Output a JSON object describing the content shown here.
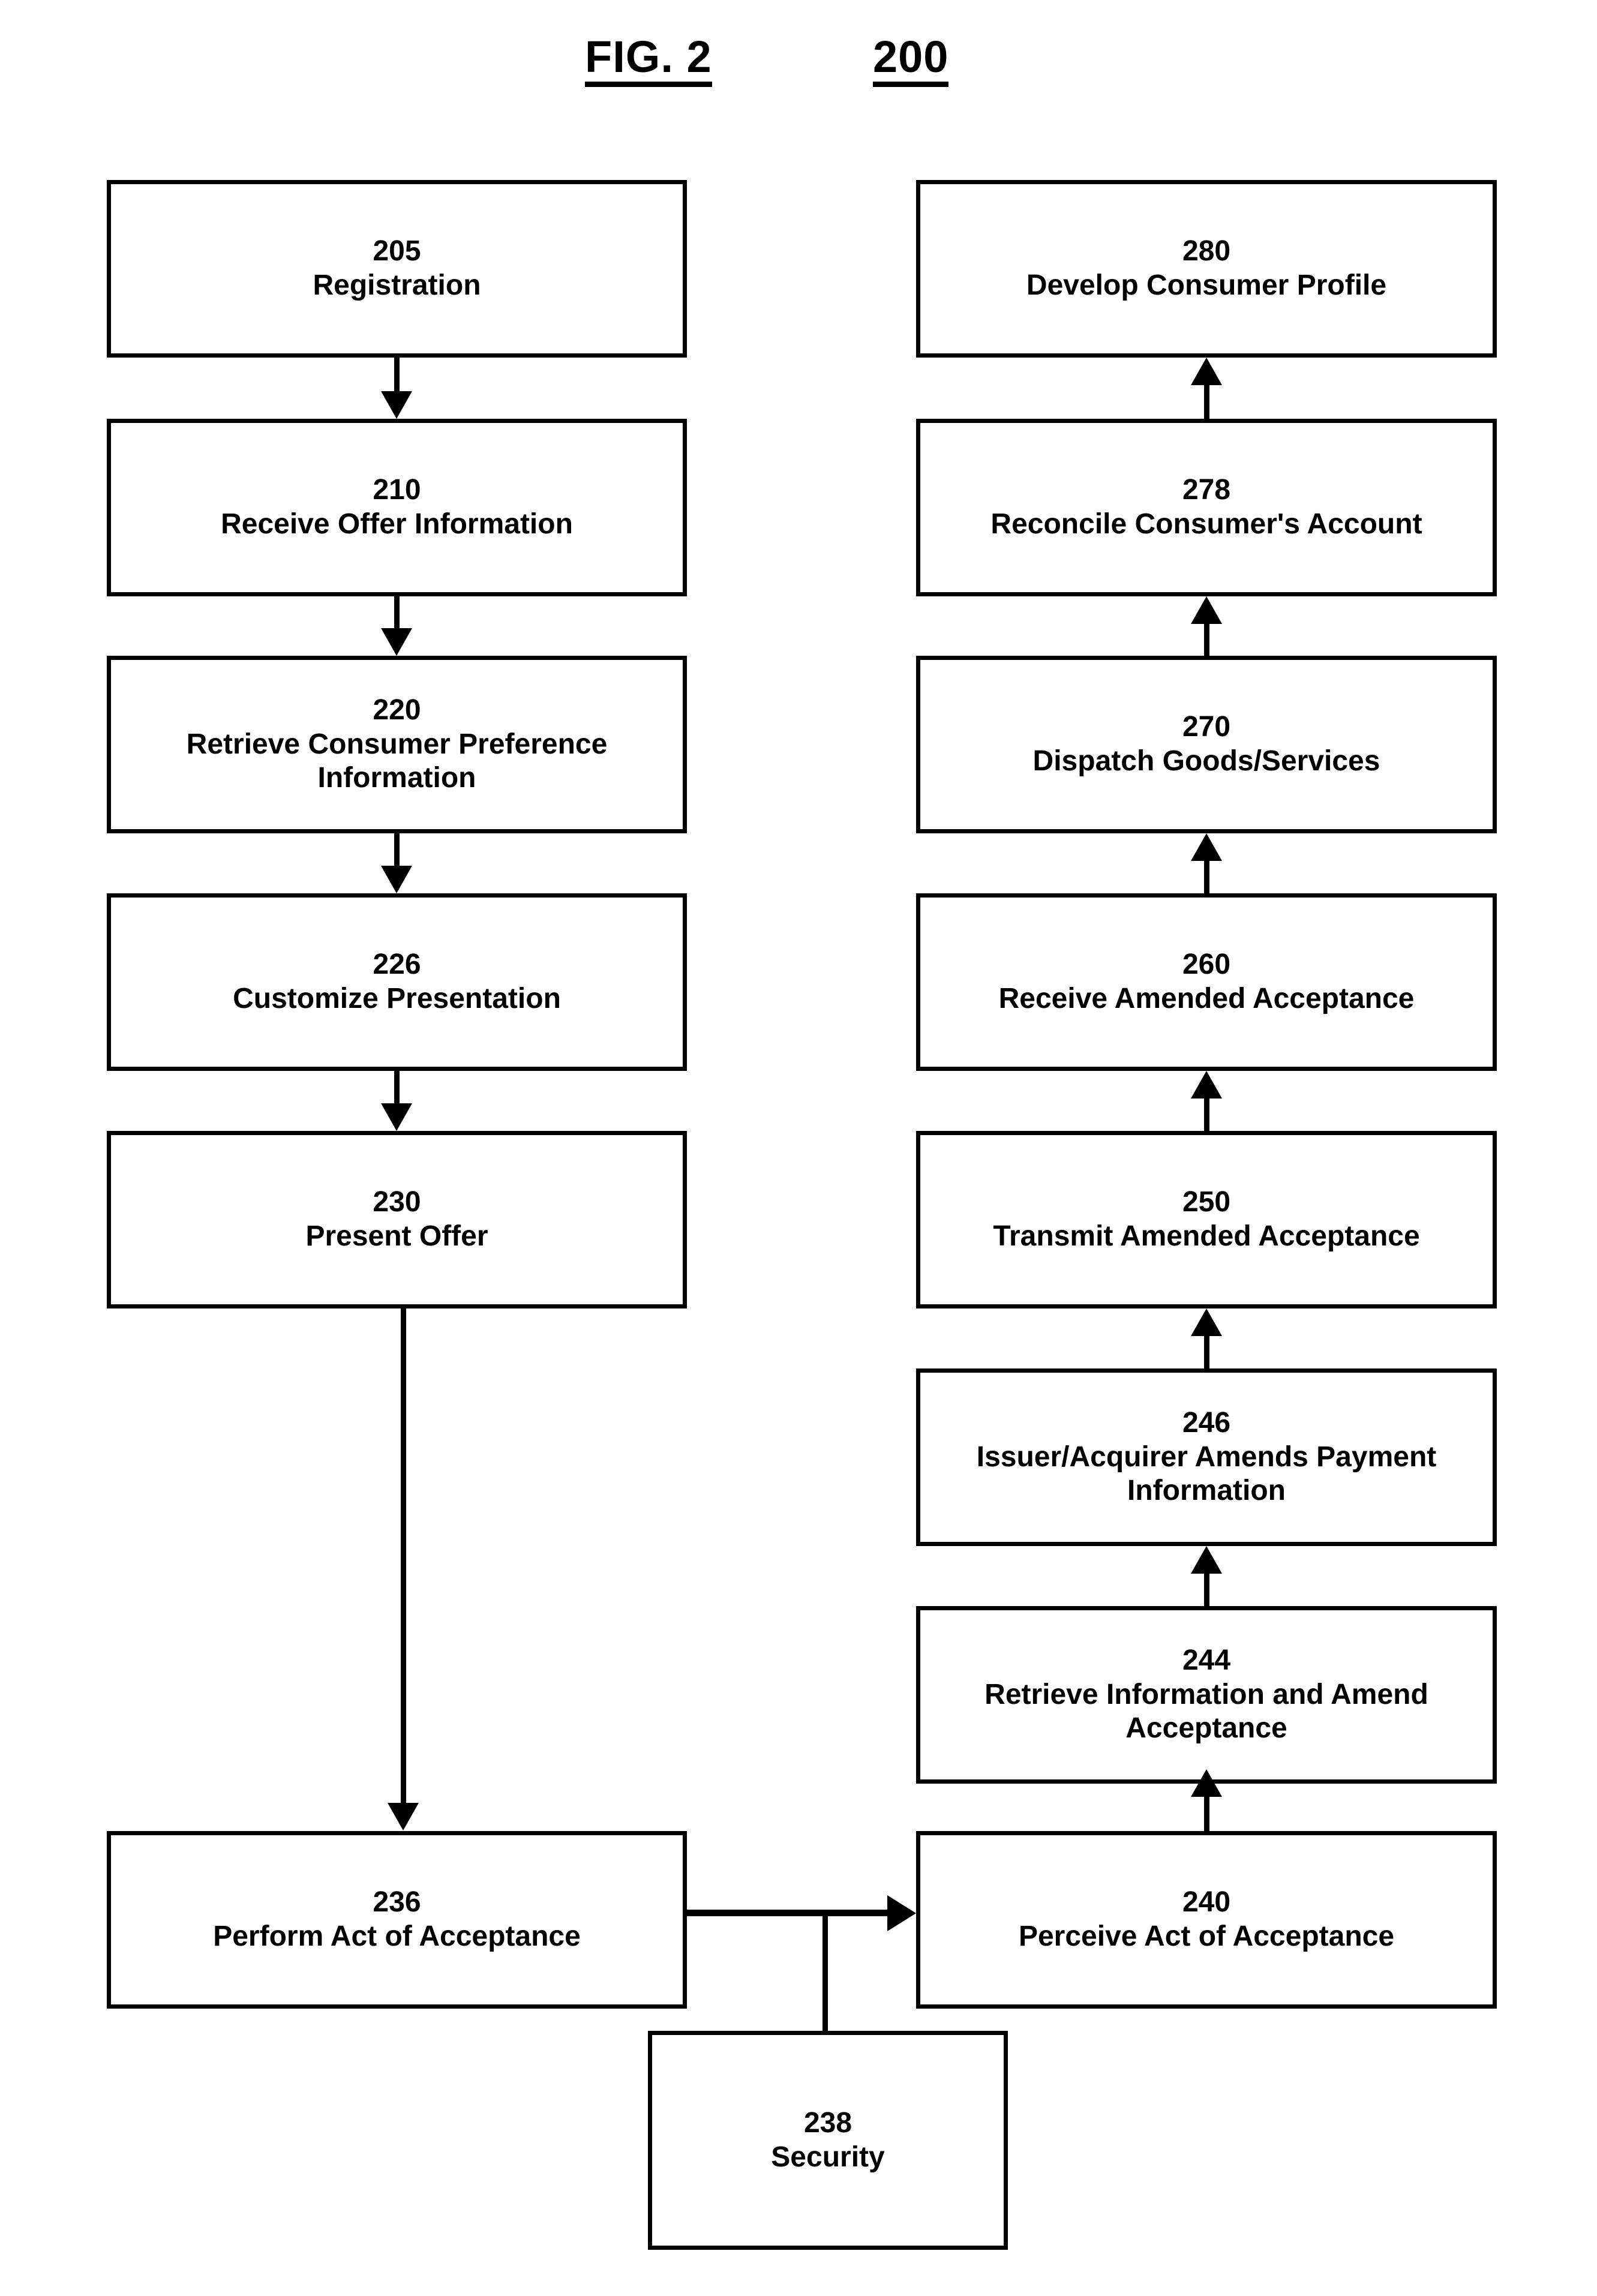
{
  "figure": {
    "label": "FIG. 2",
    "number": "200"
  },
  "diagram": {
    "type": "flowchart",
    "left_column": [
      {
        "num": "205",
        "label": "Registration"
      },
      {
        "num": "210",
        "label": "Receive Offer Information"
      },
      {
        "num": "220",
        "label": "Retrieve Consumer Preference Information"
      },
      {
        "num": "226",
        "label": "Customize Presentation"
      },
      {
        "num": "230",
        "label": "Present Offer"
      },
      {
        "num": "236",
        "label": "Perform Act of Acceptance"
      }
    ],
    "right_column": [
      {
        "num": "280",
        "label": "Develop Consumer Profile"
      },
      {
        "num": "278",
        "label": "Reconcile Consumer's Account"
      },
      {
        "num": "270",
        "label": "Dispatch Goods/Services"
      },
      {
        "num": "260",
        "label": "Receive Amended Acceptance"
      },
      {
        "num": "250",
        "label": "Transmit Amended Acceptance"
      },
      {
        "num": "246",
        "label": "Issuer/Acquirer Amends Payment Information"
      },
      {
        "num": "244",
        "label": "Retrieve Information and Amend Acceptance"
      },
      {
        "num": "240",
        "label": "Perceive Act of Acceptance"
      }
    ],
    "bottom": [
      {
        "num": "238",
        "label": "Security"
      }
    ],
    "connections": [
      {
        "from": "205",
        "to": "210",
        "direction": "down"
      },
      {
        "from": "210",
        "to": "220",
        "direction": "down"
      },
      {
        "from": "220",
        "to": "226",
        "direction": "down"
      },
      {
        "from": "226",
        "to": "230",
        "direction": "down"
      },
      {
        "from": "230",
        "to": "236",
        "direction": "down"
      },
      {
        "from": "236",
        "to": "240",
        "direction": "right"
      },
      {
        "from": "236-240-link",
        "to": "238",
        "direction": "down"
      },
      {
        "from": "240",
        "to": "244",
        "direction": "up"
      },
      {
        "from": "244",
        "to": "246",
        "direction": "up"
      },
      {
        "from": "246",
        "to": "250",
        "direction": "up"
      },
      {
        "from": "250",
        "to": "260",
        "direction": "up"
      },
      {
        "from": "260",
        "to": "270",
        "direction": "up"
      },
      {
        "from": "270",
        "to": "278",
        "direction": "up"
      },
      {
        "from": "278",
        "to": "280",
        "direction": "up"
      }
    ]
  },
  "colors": {
    "stroke": "#000000",
    "background": "#ffffff"
  }
}
